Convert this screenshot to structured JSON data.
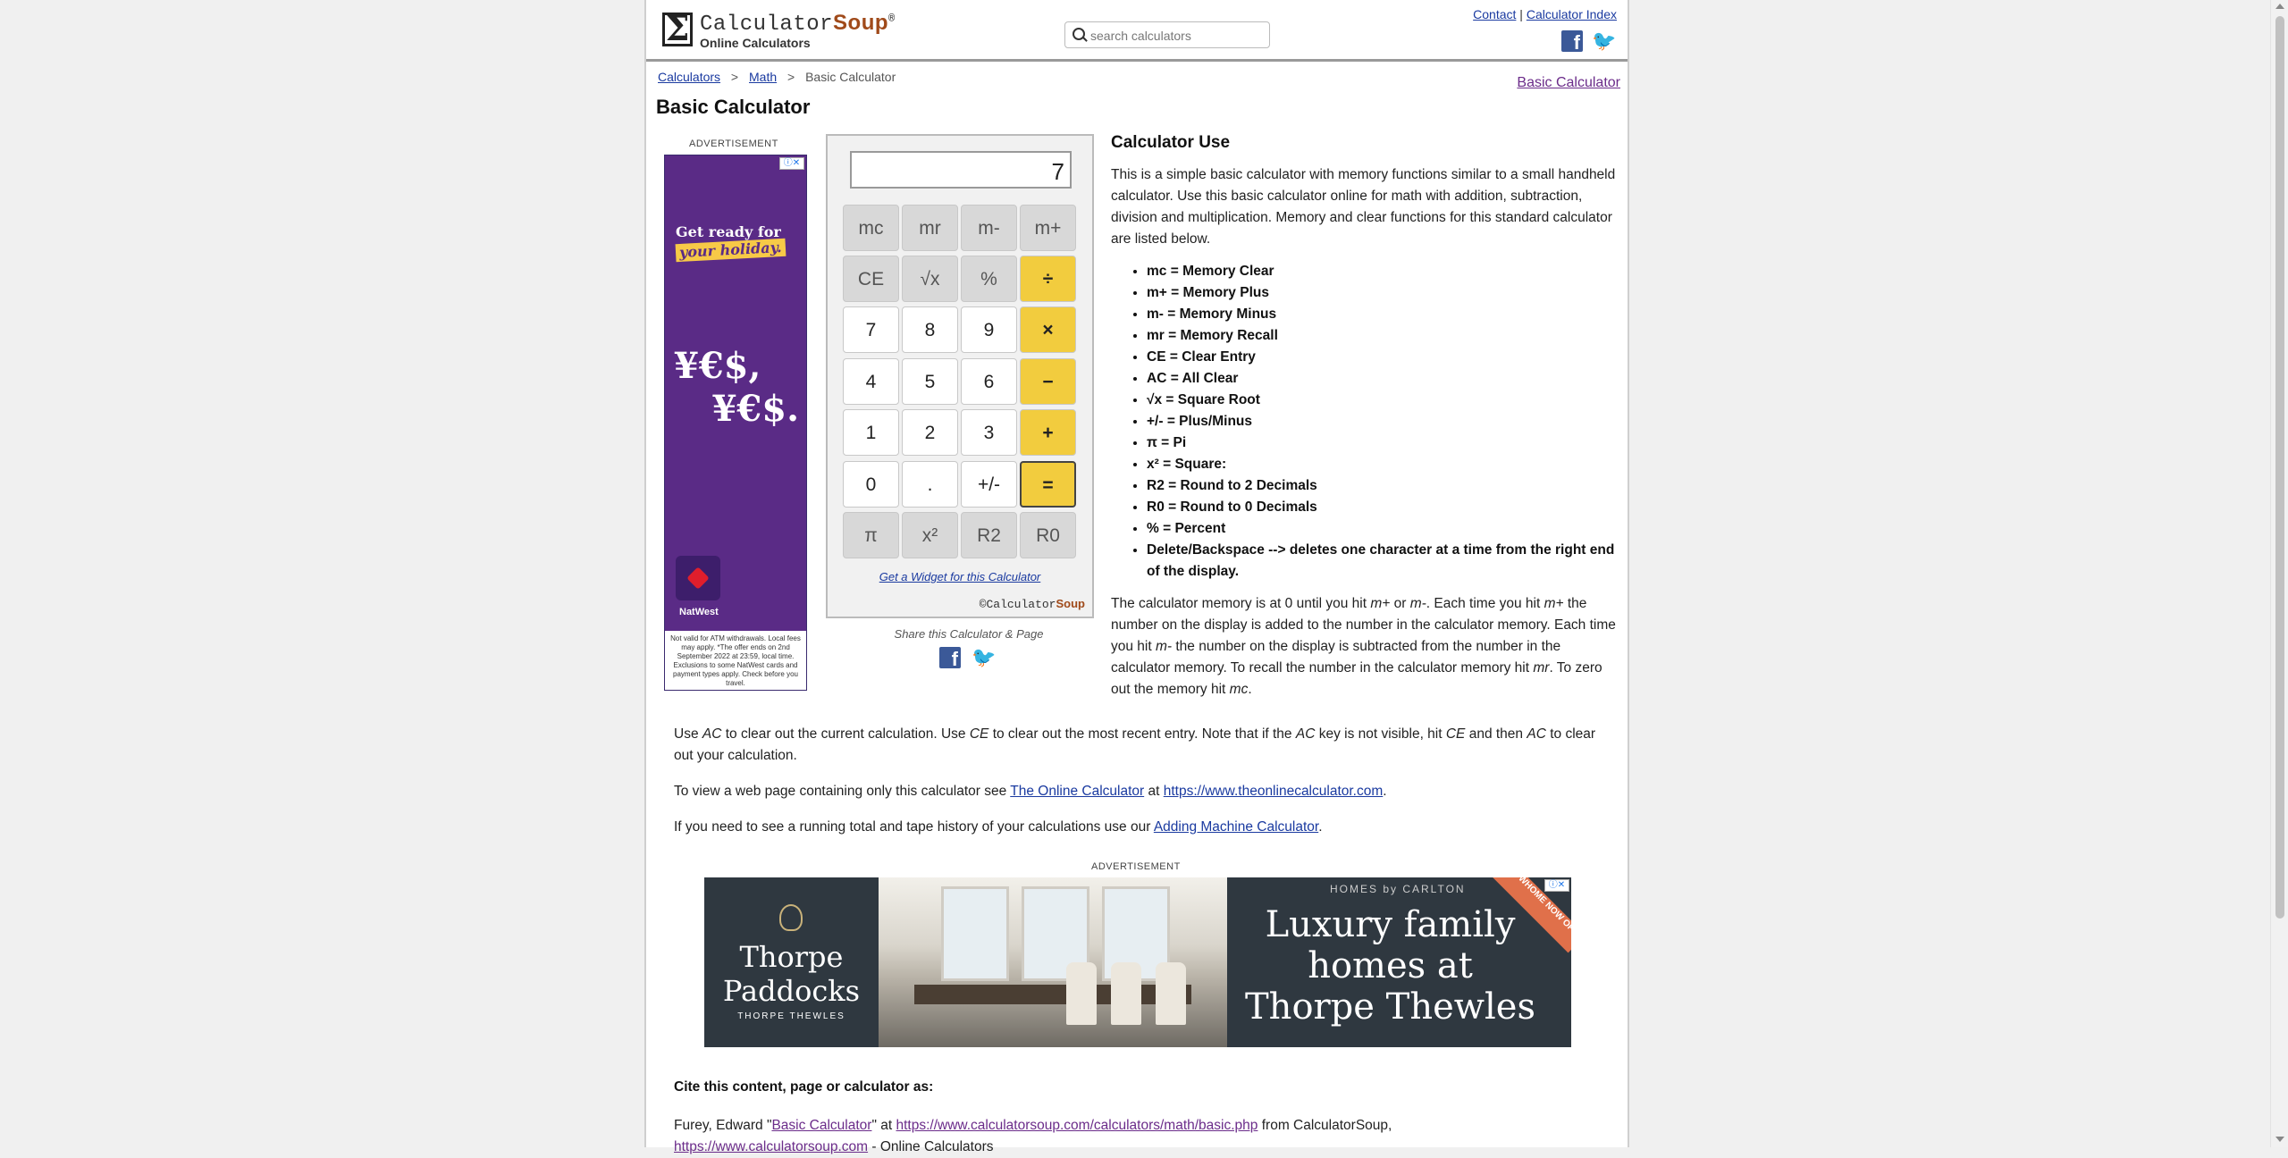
{
  "header": {
    "logo_prefix": "Calculator",
    "logo_soup": "Soup",
    "logo_reg": "®",
    "tagline": "Online Calculators",
    "search_placeholder": "search calculators",
    "contact_link": "Contact",
    "link_sep": "|",
    "index_link": "Calculator Index",
    "facebook_glyph": "f",
    "twitter_glyph": "🐦"
  },
  "breadcrumb": {
    "items": [
      "Calculators",
      "Math",
      "Basic Calculator"
    ],
    "sep": ">"
  },
  "page_title": "Basic Calculator",
  "related_link": "Basic Calculator",
  "ad_left": {
    "label": "ADVERTISEMENT",
    "close": "ⓘ✕",
    "headline_1": "Get ready for",
    "headline_2": "your holiday.",
    "yes_1": "¥€$,",
    "yes_2": "¥€$.",
    "brand": "NatWest",
    "footer": "Not valid for ATM withdrawals. Local fees may apply. *The offer ends on 2nd September 2022 at 23:59, local time. Exclusions to some NatWest cards and payment types apply. Check before you travel."
  },
  "calculator": {
    "display": "7",
    "buttons": {
      "mc": "mc",
      "mr": "mr",
      "mminus": "m-",
      "mplus": "m+",
      "ce": "CE",
      "sqrt": "√x",
      "percent": "%",
      "divide": "÷",
      "n7": "7",
      "n8": "8",
      "n9": "9",
      "multiply": "×",
      "n4": "4",
      "n5": "5",
      "n6": "6",
      "minus": "−",
      "n1": "1",
      "n2": "2",
      "n3": "3",
      "plus": "+",
      "n0": "0",
      "dot": ".",
      "plusminus": "+/-",
      "equals": "=",
      "pi": "π",
      "square": "x²",
      "r2": "R2",
      "r0": "R0"
    },
    "widget_link": "Get a Widget for this Calculator",
    "brand_prefix": "©Calculator",
    "brand_soup": "Soup"
  },
  "share": {
    "text": "Share this Calculator & Page"
  },
  "calculator_use": {
    "title": "Calculator Use",
    "intro": "This is a simple basic calculator with memory functions similar to a small handheld calculator. Use this basic calculator online for math with addition, subtraction, division and multiplication. Memory and clear functions for this standard calculator are listed below.",
    "keys": [
      "mc = Memory Clear",
      "m+ = Memory Plus",
      "m- = Memory Minus",
      "mr = Memory Recall",
      "CE = Clear Entry",
      "AC = All Clear",
      "√x = Square Root",
      "+/- = Plus/Minus",
      "π = Pi",
      "x² = Square:",
      "R2 = Round to 2 Decimals",
      "R0 = Round to 0 Decimals",
      "% = Percent",
      "Delete/Backspace --> deletes one character at a time from the right end of the display."
    ],
    "memory_p": {
      "t1": "The calculator memory is at 0 until you hit ",
      "k1": "m+",
      "t2": " or ",
      "k2": "m-",
      "t3": ". Each time you hit ",
      "k3": "m+",
      "t4": " the number on the display is added to the number in the calculator memory. Each time you hit ",
      "k4": "m-",
      "t5": " the number on the display is subtracted from the number in the calculator memory. To recall the number in the calculator memory hit ",
      "k5": "mr",
      "t6": ". To zero out the memory hit ",
      "k6": "mc",
      "t7": "."
    }
  },
  "bottom": {
    "ac_p": {
      "t1": "Use ",
      "k1": "AC",
      "t2": " to clear out the current calculation. Use ",
      "k2": "CE",
      "t3": " to clear out the most recent entry. Note that if the ",
      "k3": "AC",
      "t4": " key is not visible, hit ",
      "k4": "CE",
      "t5": " and then ",
      "k5": "AC",
      "t6": " to clear out your calculation."
    },
    "view_p": {
      "t1": "To view a web page containing only this calculator see ",
      "link1": "The Online Calculator",
      "t2": " at ",
      "link2": "https://www.theonlinecalculator.com",
      "t3": "."
    },
    "tape_p": {
      "t1": "If you need to see a running total and tape history of your calculations use our ",
      "link": "Adding Machine Calculator",
      "t2": "."
    }
  },
  "ad_bottom": {
    "label": "ADVERTISEMENT",
    "close": "ⓘ✕",
    "brand_1": "Thorpe",
    "brand_2": "Paddocks",
    "sub": "THORPE THEWLES",
    "homes": "HOMES by CARLTON",
    "headline_1": "Luxury family",
    "headline_2": "homes at",
    "headline_3": "Thorpe Thewles",
    "ribbon": "SHOWHOME NOW OPEN"
  },
  "cite": {
    "title": "Cite this content, page or calculator as:",
    "t1": "Furey, Edward \"",
    "link1": "Basic Calculator",
    "t2": "\" at ",
    "link2": "https://www.calculatorsoup.com/calculators/math/basic.php",
    "t3": " from CalculatorSoup,",
    "link3": "https://www.calculatorsoup.com",
    "t4": " - Online Calculators"
  }
}
